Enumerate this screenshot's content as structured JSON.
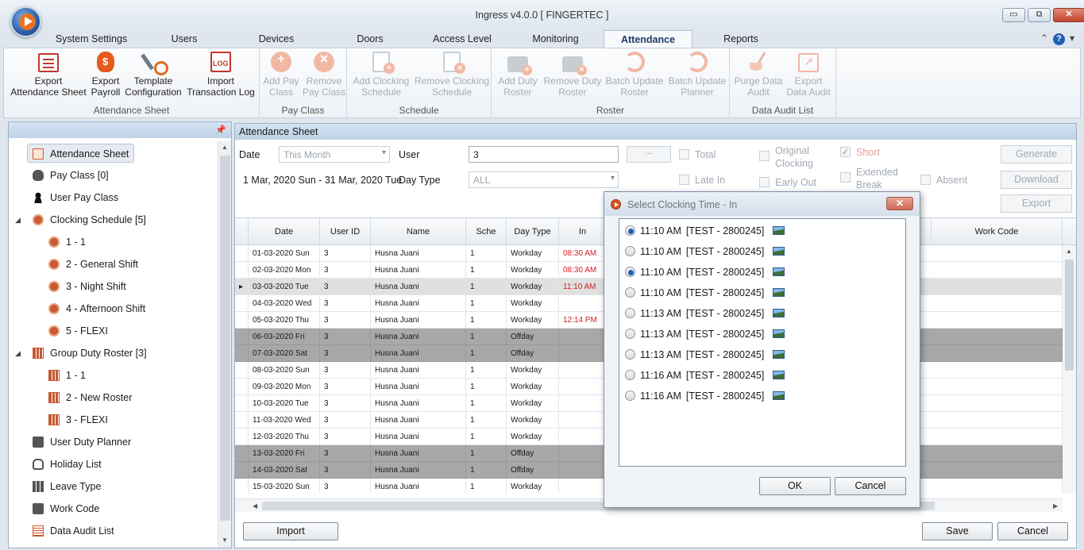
{
  "window": {
    "title": "Ingress v4.0.0 [ FINGERTEC ]",
    "minimize": "▭",
    "restore": "⧉",
    "close": "✕"
  },
  "tabs": [
    "System Settings",
    "Users",
    "Devices",
    "Doors",
    "Access Level",
    "Monitoring",
    "Attendance",
    "Reports"
  ],
  "active_tab": "Attendance",
  "help": {
    "collapse": "⌃",
    "icon": "?",
    "menu": "▾"
  },
  "ribbon": {
    "groups": [
      {
        "label": "Attendance Sheet",
        "buttons": [
          {
            "label": "Export\nAttendance Sheet",
            "icon": "sheet-icon",
            "enabled": true
          },
          {
            "label": "Export\nPayroll",
            "icon": "money-bag-icon",
            "enabled": true
          },
          {
            "label": "Template\nConfiguration",
            "icon": "tools-icon",
            "enabled": true
          },
          {
            "label": "Import\nTransaction Log",
            "icon": "log-icon",
            "enabled": true
          }
        ]
      },
      {
        "label": "Pay Class",
        "buttons": [
          {
            "label": "Add Pay\nClass",
            "icon": "add-icon",
            "enabled": false
          },
          {
            "label": "Remove\nPay Class",
            "icon": "remove-icon",
            "enabled": false
          }
        ]
      },
      {
        "label": "Schedule",
        "buttons": [
          {
            "label": "Add Clocking\nSchedule",
            "icon": "add-schedule-icon",
            "enabled": false
          },
          {
            "label": "Remove Clocking\nSchedule",
            "icon": "remove-schedule-icon",
            "enabled": false
          }
        ]
      },
      {
        "label": "Roster",
        "buttons": [
          {
            "label": "Add Duty\nRoster",
            "icon": "add-roster-icon",
            "enabled": false
          },
          {
            "label": "Remove Duty\nRoster",
            "icon": "remove-roster-icon",
            "enabled": false
          },
          {
            "label": "Batch Update\nRoster",
            "icon": "sync-icon",
            "enabled": false
          },
          {
            "label": "Batch Update\nPlanner",
            "icon": "sync-icon",
            "enabled": false
          }
        ]
      },
      {
        "label": "Data Audit List",
        "buttons": [
          {
            "label": "Purge Data\nAudit",
            "icon": "broom-icon",
            "enabled": false
          },
          {
            "label": "Export\nData Audit",
            "icon": "export-icon",
            "enabled": false
          }
        ]
      }
    ]
  },
  "left_panel": {
    "pin": "📌",
    "items": [
      {
        "label": "Attendance Sheet",
        "icon": "sheet-icon",
        "level": 0,
        "selected": true
      },
      {
        "label": "Pay Class [0]",
        "icon": "money-bag-icon",
        "level": 0
      },
      {
        "label": "User Pay Class",
        "icon": "user-icon",
        "level": 0
      },
      {
        "label": "Clocking Schedule [5]",
        "icon": "clock-icon",
        "level": 0,
        "expanded": true
      },
      {
        "label": "1 - 1",
        "icon": "clock-icon",
        "level": 1
      },
      {
        "label": "2 - General Shift",
        "icon": "clock-icon",
        "level": 1
      },
      {
        "label": "3 - Night Shift",
        "icon": "clock-icon",
        "level": 1
      },
      {
        "label": "4 - Afternoon Shift",
        "icon": "clock-icon",
        "level": 1
      },
      {
        "label": "5 - FLEXI",
        "icon": "clock-icon",
        "level": 1
      },
      {
        "label": "Group Duty Roster [3]",
        "icon": "roster-icon",
        "level": 0,
        "expanded": true
      },
      {
        "label": "1 - 1",
        "icon": "roster-icon",
        "level": 1
      },
      {
        "label": "2 - New Roster",
        "icon": "roster-icon",
        "level": 1
      },
      {
        "label": "3 - FLEXI",
        "icon": "roster-icon",
        "level": 1
      },
      {
        "label": "User Duty Planner",
        "icon": "briefcase-icon",
        "level": 0
      },
      {
        "label": "Holiday List",
        "icon": "flipflops-icon",
        "level": 0
      },
      {
        "label": "Leave Type",
        "icon": "grid-icon",
        "level": 0
      },
      {
        "label": "Work Code",
        "icon": "chat-icon",
        "level": 0
      },
      {
        "label": "Data Audit List",
        "icon": "list-icon",
        "level": 0
      }
    ]
  },
  "main": {
    "header": "Attendance Sheet",
    "filters": {
      "date_label": "Date",
      "date_value": "This Month",
      "date_range": "1 Mar, 2020 Sun - 31 Mar, 2020 Tue",
      "user_label": "User",
      "user_value": "3",
      "user_browse": "...",
      "daytype_label": "Day Type",
      "daytype_value": "ALL",
      "checks": [
        {
          "label": "Total",
          "checked": false
        },
        {
          "label": "Original\nClocking",
          "checked": false
        },
        {
          "label": "Short",
          "checked": true
        },
        {
          "label": "Late In",
          "checked": false
        },
        {
          "label": "Early Out",
          "checked": false
        },
        {
          "label": "Extended\nBreak",
          "checked": false
        },
        {
          "label": "Absent",
          "checked": false
        }
      ],
      "generate": "Generate",
      "download": "Download",
      "export": "Export"
    },
    "table": {
      "columns": [
        "Date",
        "User ID",
        "Name",
        "Sche",
        "Day Type",
        "In",
        "Work Code"
      ],
      "rows": [
        {
          "date": "01-03-2020",
          "day": "Sun",
          "user_id": "3",
          "name": "Husna Juani",
          "sche": "1",
          "day_type": "Workday",
          "in": "08:30 AM"
        },
        {
          "date": "02-03-2020",
          "day": "Mon",
          "user_id": "3",
          "name": "Husna Juani",
          "sche": "1",
          "day_type": "Workday",
          "in": "08:30 AM"
        },
        {
          "date": "03-03-2020",
          "day": "Tue",
          "user_id": "3",
          "name": "Husna Juani",
          "sche": "1",
          "day_type": "Workday",
          "in": "11:10 AM",
          "current": true
        },
        {
          "date": "04-03-2020",
          "day": "Wed",
          "user_id": "3",
          "name": "Husna Juani",
          "sche": "1",
          "day_type": "Workday",
          "in": ""
        },
        {
          "date": "05-03-2020",
          "day": "Thu",
          "user_id": "3",
          "name": "Husna Juani",
          "sche": "1",
          "day_type": "Workday",
          "in": "12:14 PM"
        },
        {
          "date": "06-03-2020",
          "day": "Fri",
          "user_id": "3",
          "name": "Husna Juani",
          "sche": "1",
          "day_type": "Offday",
          "in": ""
        },
        {
          "date": "07-03-2020",
          "day": "Sat",
          "user_id": "3",
          "name": "Husna Juani",
          "sche": "1",
          "day_type": "Offday",
          "in": ""
        },
        {
          "date": "08-03-2020",
          "day": "Sun",
          "user_id": "3",
          "name": "Husna Juani",
          "sche": "1",
          "day_type": "Workday",
          "in": ""
        },
        {
          "date": "09-03-2020",
          "day": "Mon",
          "user_id": "3",
          "name": "Husna Juani",
          "sche": "1",
          "day_type": "Workday",
          "in": ""
        },
        {
          "date": "10-03-2020",
          "day": "Tue",
          "user_id": "3",
          "name": "Husna Juani",
          "sche": "1",
          "day_type": "Workday",
          "in": ""
        },
        {
          "date": "11-03-2020",
          "day": "Wed",
          "user_id": "3",
          "name": "Husna Juani",
          "sche": "1",
          "day_type": "Workday",
          "in": ""
        },
        {
          "date": "12-03-2020",
          "day": "Thu",
          "user_id": "3",
          "name": "Husna Juani",
          "sche": "1",
          "day_type": "Workday",
          "in": ""
        },
        {
          "date": "13-03-2020",
          "day": "Fri",
          "user_id": "3",
          "name": "Husna Juani",
          "sche": "1",
          "day_type": "Offday",
          "in": ""
        },
        {
          "date": "14-03-2020",
          "day": "Sat",
          "user_id": "3",
          "name": "Husna Juani",
          "sche": "1",
          "day_type": "Offday",
          "in": ""
        },
        {
          "date": "15-03-2020",
          "day": "Sun",
          "user_id": "3",
          "name": "Husna Juani",
          "sche": "1",
          "day_type": "Workday",
          "in": ""
        }
      ]
    },
    "import": "Import",
    "save": "Save",
    "cancel": "Cancel"
  },
  "dialog": {
    "title": "Select Clocking Time - In",
    "close": "✕",
    "options": [
      {
        "time": "11:10 AM",
        "source": "[TEST - 2800245]",
        "selected": true
      },
      {
        "time": "11:10 AM",
        "source": "[TEST - 2800245]",
        "selected": false
      },
      {
        "time": "11:10 AM",
        "source": "[TEST - 2800245]",
        "selected": true
      },
      {
        "time": "11:10 AM",
        "source": "[TEST - 2800245]",
        "selected": false
      },
      {
        "time": "11:13 AM",
        "source": "[TEST - 2800245]",
        "selected": false
      },
      {
        "time": "11:13 AM",
        "source": "[TEST - 2800245]",
        "selected": false
      },
      {
        "time": "11:13 AM",
        "source": "[TEST - 2800245]",
        "selected": false
      },
      {
        "time": "11:16 AM",
        "source": "[TEST - 2800245]",
        "selected": false
      },
      {
        "time": "11:16 AM",
        "source": "[TEST - 2800245]",
        "selected": false
      }
    ],
    "ok": "OK",
    "cancel": "Cancel"
  },
  "colors": {
    "accent": "#1e3b6a",
    "time_red": "#d21f1f",
    "offday_gray": "#a8a8a8",
    "radio_blue": "#1d5fb8"
  }
}
